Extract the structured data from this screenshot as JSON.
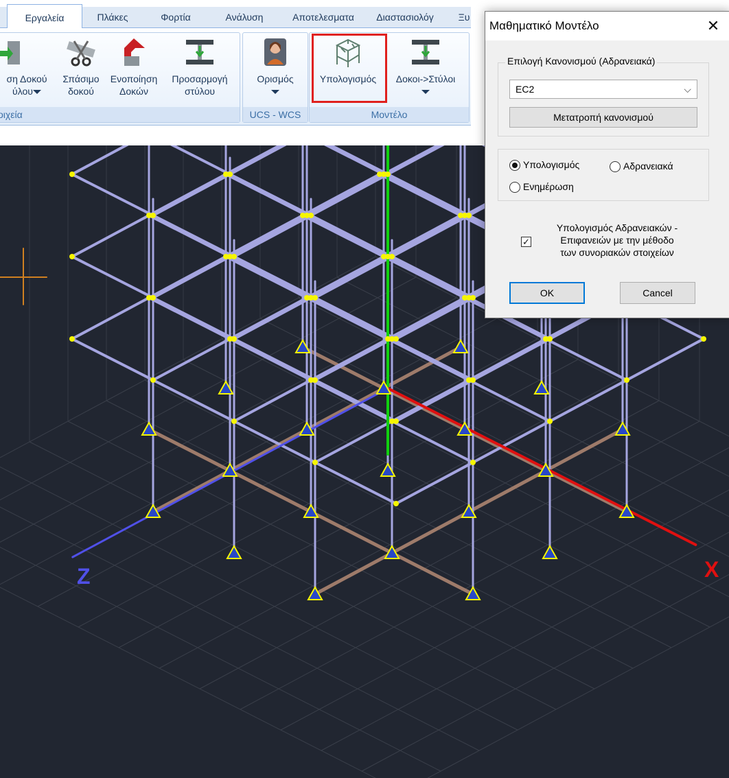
{
  "ribbon": {
    "tabs": [
      {
        "label": "Εργαλεία",
        "active": true
      },
      {
        "label": "Πλάκες",
        "active": false
      },
      {
        "label": "Φορτία",
        "active": false
      },
      {
        "label": "Ανάλυση",
        "active": false
      },
      {
        "label": "Αποτελεσματα",
        "active": false
      },
      {
        "label": "Διαστασιολόγ",
        "active": false
      },
      {
        "label": "Ξυ",
        "active": false
      }
    ],
    "buttons": {
      "cut_left": {
        "line1": "ση Δοκού",
        "line2": "ύλου"
      },
      "split_beam": {
        "line1": "Σπάσιμο",
        "line2": "δοκού"
      },
      "merge_beams": {
        "line1": "Ενοποίηση",
        "line2": "Δοκών"
      },
      "adjust_column": {
        "line1": "Προσαρμογή",
        "line2": "στύλου"
      },
      "define": {
        "line1": "Ορισμός"
      },
      "calculate": {
        "line1": "Υπολογισμός"
      },
      "beams_to_columns": {
        "line1": "Δοκοι->Στύλοι"
      }
    },
    "groups": {
      "elements": "οιχεία",
      "ucs_wcs": "UCS - WCS",
      "model": "Μοντέλο"
    }
  },
  "viewport": {
    "axis_x_label": "X",
    "axis_z_label": "Z",
    "colors": {
      "background": "#212631",
      "frame": "#a5a5e0",
      "foundation": "#9e7b6a",
      "node": "#f6f600",
      "support": "#2848c8",
      "axis_x": "#e01010",
      "axis_y": "#10d010",
      "axis_z": "#5050e8",
      "cursor": "#d08020"
    }
  },
  "dialog": {
    "title": "Μαθηματικό Μοντέλο",
    "close_glyph": "✕",
    "code_group_label": "Επιλογή Κανονισμού (Αδρανειακά)",
    "code_selected": "EC2",
    "convert_button": "Μετατροπή κανονισμού",
    "radio_calculation": "Υπολογισμός",
    "radio_inertia": "Αδρανειακά",
    "radio_update": "Ενημέρωση",
    "selected_radio": "calculation",
    "checkbox_line1": "Υπολογισμός Αδρανειακών -",
    "checkbox_line2": "Επιφανειών με την μέθοδο",
    "checkbox_line3": "των συνοριακών στοιχείων",
    "checkbox_checked": true,
    "ok_button": "OK",
    "cancel_button": "Cancel"
  }
}
